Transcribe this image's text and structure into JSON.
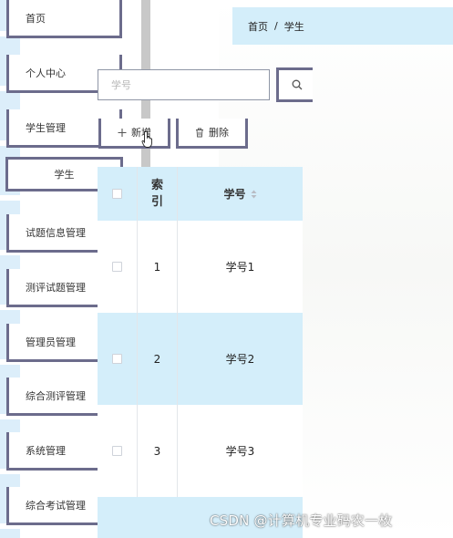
{
  "sidebar": {
    "items": [
      {
        "label": "首页",
        "has_chevron": false
      },
      {
        "label": "个人中心",
        "has_chevron": true
      },
      {
        "label": "学生管理",
        "has_chevron": true
      },
      {
        "label": "学生",
        "has_chevron": false
      },
      {
        "label": "试题信息管理",
        "has_chevron": true
      },
      {
        "label": "测评试题管理",
        "has_chevron": true
      },
      {
        "label": "管理员管理",
        "has_chevron": true
      },
      {
        "label": "综合测评管理",
        "has_chevron": true
      },
      {
        "label": "系统管理",
        "has_chevron": true
      },
      {
        "label": "综合考试管理",
        "has_chevron": true
      }
    ]
  },
  "breadcrumb": {
    "home": "首页",
    "separator": "/",
    "current": "学生"
  },
  "search": {
    "placeholder": "学号"
  },
  "toolbar": {
    "add_label": "新增",
    "delete_label": "删除"
  },
  "table": {
    "headers": {
      "index": "索引",
      "student_id": "学号"
    },
    "rows": [
      {
        "index": "1",
        "student_id": "学号1"
      },
      {
        "index": "2",
        "student_id": "学号2"
      },
      {
        "index": "3",
        "student_id": "学号3"
      }
    ]
  },
  "watermark": "CSDN @计算机专业码农一枚",
  "colors": {
    "accent_border": "#6c6c8c",
    "header_bg": "#d4eefa",
    "divider": "#c8c8c8"
  }
}
